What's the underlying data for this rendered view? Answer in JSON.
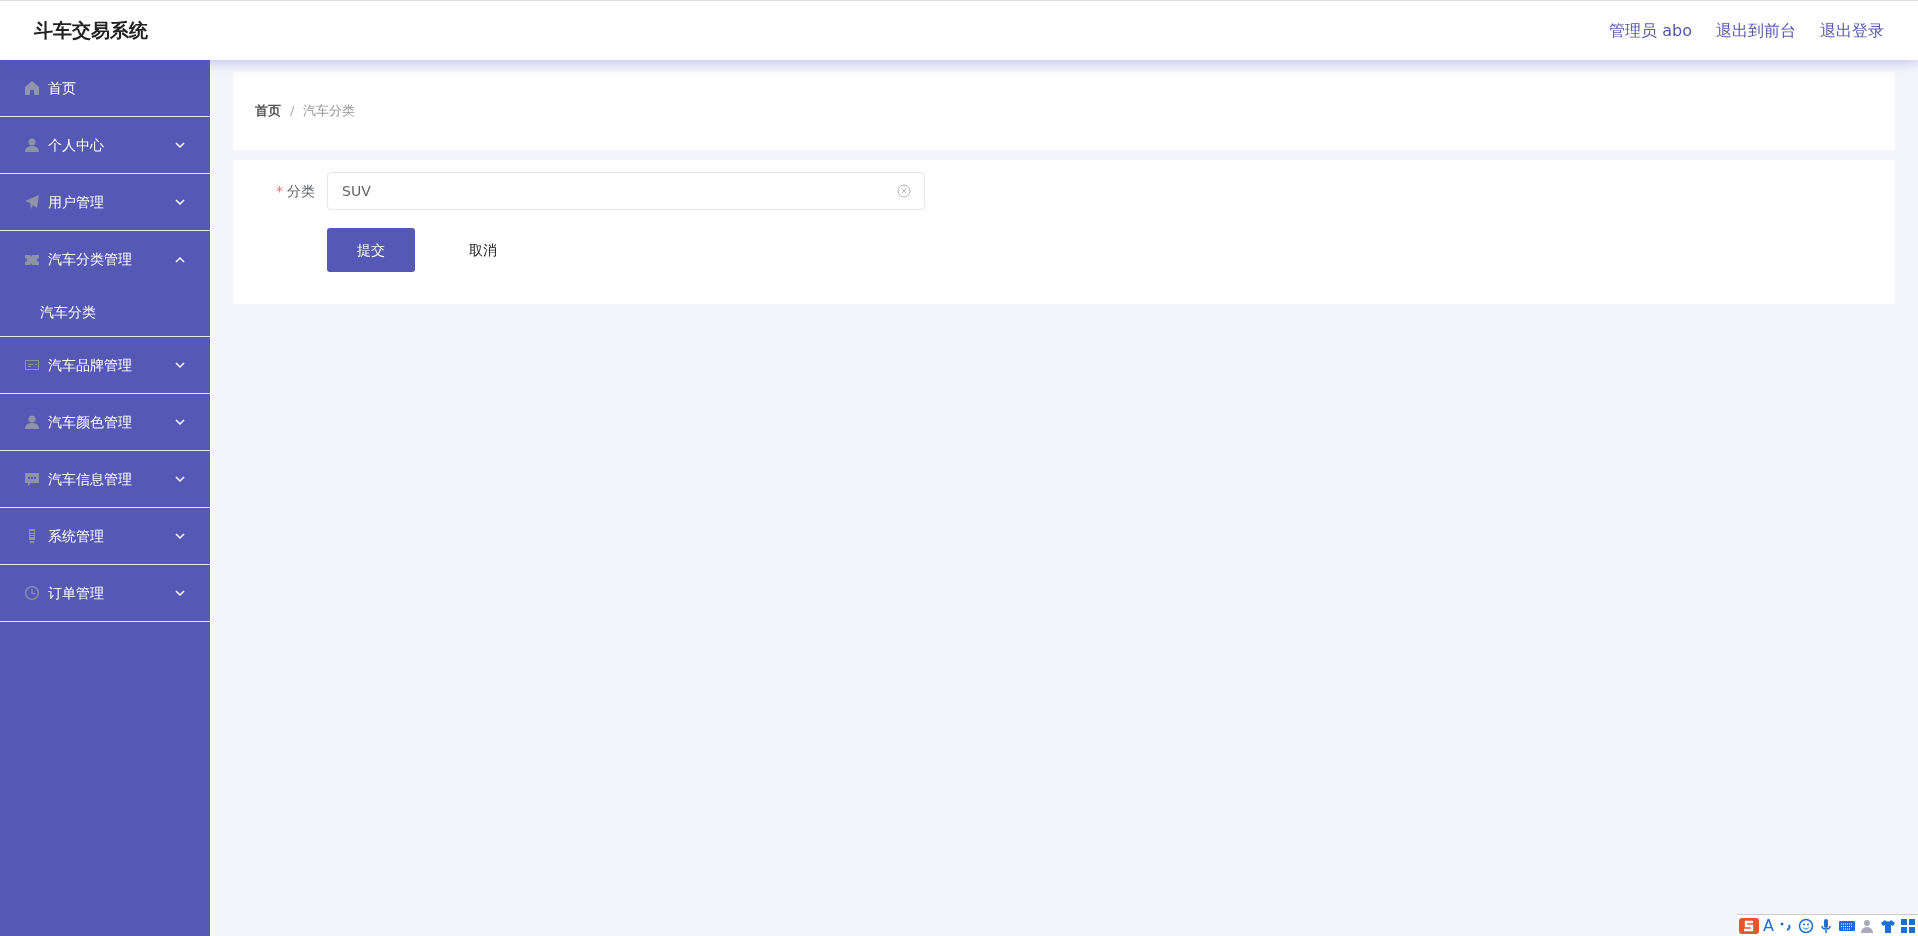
{
  "header": {
    "title": "斗车交易系统",
    "links": [
      "管理员 abo",
      "退出到前台",
      "退出登录"
    ]
  },
  "sidebar": {
    "items": [
      {
        "label": "首页"
      },
      {
        "label": "个人中心",
        "expanded": false
      },
      {
        "label": "用户管理",
        "expanded": false
      },
      {
        "label": "汽车分类管理",
        "expanded": true,
        "children": [
          {
            "label": "汽车分类"
          }
        ]
      },
      {
        "label": "汽车品牌管理",
        "expanded": false
      },
      {
        "label": "汽车颜色管理",
        "expanded": false
      },
      {
        "label": "汽车信息管理",
        "expanded": false
      },
      {
        "label": "系统管理",
        "expanded": false
      },
      {
        "label": "订单管理",
        "expanded": false
      }
    ]
  },
  "breadcrumb": {
    "items": [
      "首页",
      "汽车分类"
    ],
    "separator": "/"
  },
  "form": {
    "fields": [
      {
        "label": "分类",
        "required_mark": "*",
        "value": "SUV"
      }
    ],
    "buttons": [
      {
        "label": "提交",
        "kind": "primary"
      },
      {
        "label": "取消",
        "kind": "plain"
      }
    ]
  },
  "ime_toolbar": {
    "mode": "A"
  }
}
